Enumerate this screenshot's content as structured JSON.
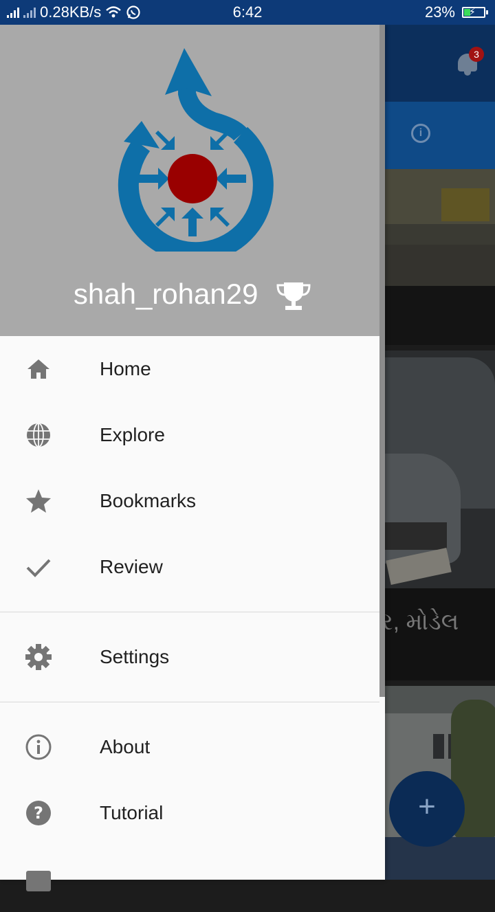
{
  "status_bar": {
    "speed": "0.28KB/s",
    "time": "6:42",
    "battery": "23%"
  },
  "main": {
    "notification_count": "3",
    "card_caption": "ર, મોડેલ",
    "fab_label": "+"
  },
  "drawer": {
    "username": "shah_rohan29",
    "menu_items": [
      {
        "label": "Home",
        "icon": "home-icon"
      },
      {
        "label": "Explore",
        "icon": "globe-icon"
      },
      {
        "label": "Bookmarks",
        "icon": "star-icon"
      },
      {
        "label": "Review",
        "icon": "check-icon"
      },
      {
        "label": "Settings",
        "icon": "gear-icon"
      },
      {
        "label": "About",
        "icon": "info-icon"
      },
      {
        "label": "Tutorial",
        "icon": "help-icon"
      }
    ]
  },
  "colors": {
    "status_bar": "#0d3a78",
    "drawer_header": "#a9a9a9",
    "logo_blue": "#0e6fa8",
    "logo_red": "#990000",
    "icon_gray": "#757575"
  }
}
